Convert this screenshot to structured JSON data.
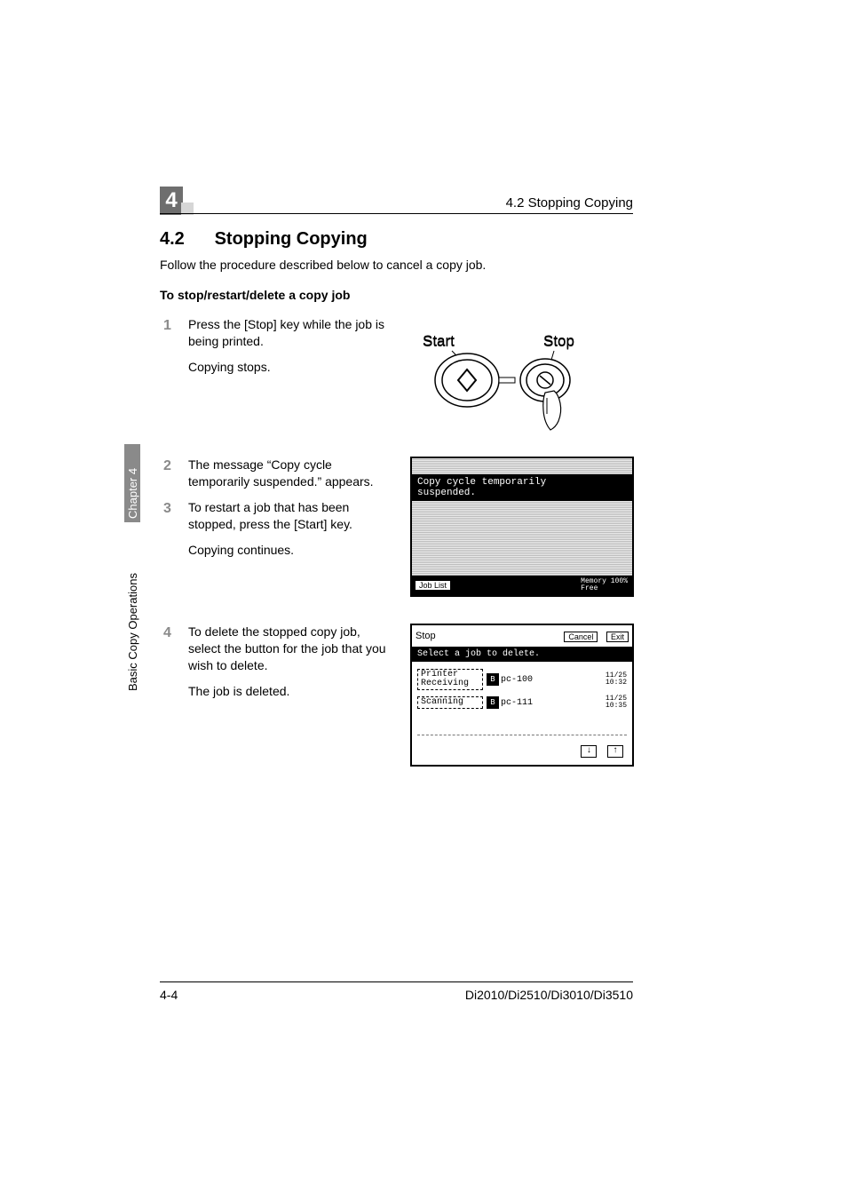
{
  "header": {
    "chapter_number": "4",
    "right": "4.2 Stopping Copying"
  },
  "section": {
    "number": "4.2",
    "title": "Stopping Copying",
    "intro": "Follow the procedure described below to cancel a copy job.",
    "subheading": "To stop/restart/delete a copy job"
  },
  "sidebar": {
    "chapter": "Chapter 4",
    "book": "Basic Copy Operations"
  },
  "steps": {
    "s1": {
      "num": "1",
      "l1": "Press the [Stop] key while the job is being printed.",
      "l2": "Copying stops."
    },
    "s2": {
      "num": "2",
      "l1": "The message “Copy cycle temporarily suspended.” appears."
    },
    "s3": {
      "num": "3",
      "l1": "To restart a job that has been stopped, press the [Start] key.",
      "l2": "Copying continues."
    },
    "s4": {
      "num": "4",
      "l1": "To delete the stopped copy job, select the button for the job that you wish to delete.",
      "l2": "The job is deleted."
    }
  },
  "fig1": {
    "start": "Start",
    "stop": "Stop"
  },
  "fig2": {
    "msg_l1": "Copy cycle temporarily",
    "msg_l2": "suspended.",
    "joblist": "Job List",
    "memory_label": "Memory",
    "memory_free": "Free",
    "memory_value": "100%"
  },
  "fig3": {
    "title": "Stop",
    "cancel": "Cancel",
    "exit": "Exit",
    "msg": "Select a job to delete.",
    "rows": [
      {
        "status_l1": "Printer",
        "status_l2": "Receiving",
        "icon": "B",
        "name": "pc-100",
        "date": "11/25",
        "time": "10:32"
      },
      {
        "status_l1": "Scanning",
        "status_l2": "",
        "icon": "B",
        "name": "pc-111",
        "date": "11/25",
        "time": "10:35"
      }
    ],
    "arrow_down": "↓",
    "arrow_up": "↑"
  },
  "footer": {
    "left": "4-4",
    "right": "Di2010/Di2510/Di3010/Di3510"
  }
}
